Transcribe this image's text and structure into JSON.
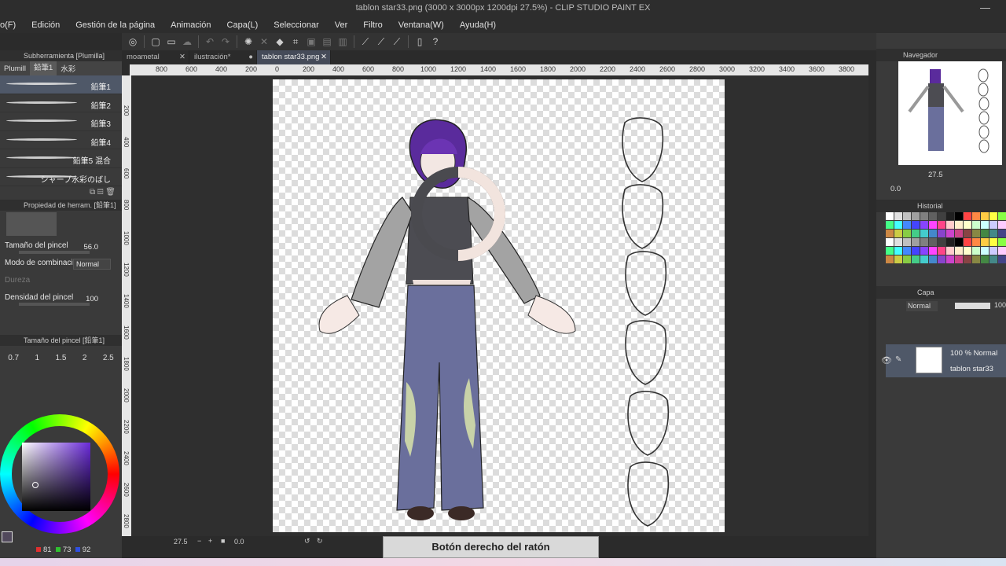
{
  "window": {
    "title": "tablon star33.png (3000 x 3000px 1200dpi 27.5%)  - CLIP STUDIO PAINT EX"
  },
  "menu": [
    "o(F)",
    "Edición",
    "Gestión de la página",
    "Animación",
    "Capa(L)",
    "Seleccionar",
    "Ver",
    "Filtro",
    "Ventana(W)",
    "Ayuda(H)"
  ],
  "subtool_panel": {
    "title": "Subherramienta [Plumilla]",
    "tabs": [
      "Plumill",
      "鉛筆1",
      "水彩"
    ],
    "brushes": [
      "鉛筆1",
      "鉛筆2",
      "鉛筆3",
      "鉛筆4",
      "鉛筆5 混合",
      "シャープ水彩のばし"
    ]
  },
  "tool_property": {
    "title": "Propiedad de herram. [鉛筆1]",
    "brush_size_label": "Tamaño del pincel",
    "brush_size_value": "56.0",
    "blend_mode_label": "Modo de combinación",
    "blend_mode_value": "Normal",
    "hardness_label": "Dureza",
    "density_label": "Densidad del pincel",
    "density_value": "100"
  },
  "brush_size_panel": {
    "title": "Tamaño del pincel [鉛筆1]",
    "sizes": [
      "0.7",
      "1",
      "1.5",
      "2",
      "2.5"
    ]
  },
  "color": {
    "r": "81",
    "g": "73",
    "b": "92",
    "current": "#51495c"
  },
  "tabs": [
    "moametal",
    "ilustración*",
    "tablon star33.png"
  ],
  "ruler_ticks": [
    "800",
    "600",
    "400",
    "200",
    "0",
    "200",
    "400",
    "600",
    "800",
    "1000",
    "1200",
    "1400",
    "1600",
    "1800",
    "2000",
    "2200",
    "2400",
    "2600",
    "2800",
    "3000",
    "3200",
    "3400",
    "3600",
    "3800"
  ],
  "ruler_left_ticks": [
    "200",
    "400",
    "600",
    "800",
    "1000",
    "1200",
    "1400",
    "1600",
    "1800",
    "2000",
    "2200",
    "2400",
    "2600",
    "2800"
  ],
  "statusbar": {
    "zoom": "27.5",
    "angle": "0.0"
  },
  "tooltip": "Botón derecho del ratón",
  "navigator": {
    "title": "Navegador",
    "zoom": "27.5",
    "angle": "0.0"
  },
  "history": {
    "title": "Historial"
  },
  "layer_panel": {
    "title": "Capa",
    "blend": "Normal",
    "opacity": "100",
    "layer_mode": "100 % Normal",
    "layer_name": "tablon star33"
  }
}
